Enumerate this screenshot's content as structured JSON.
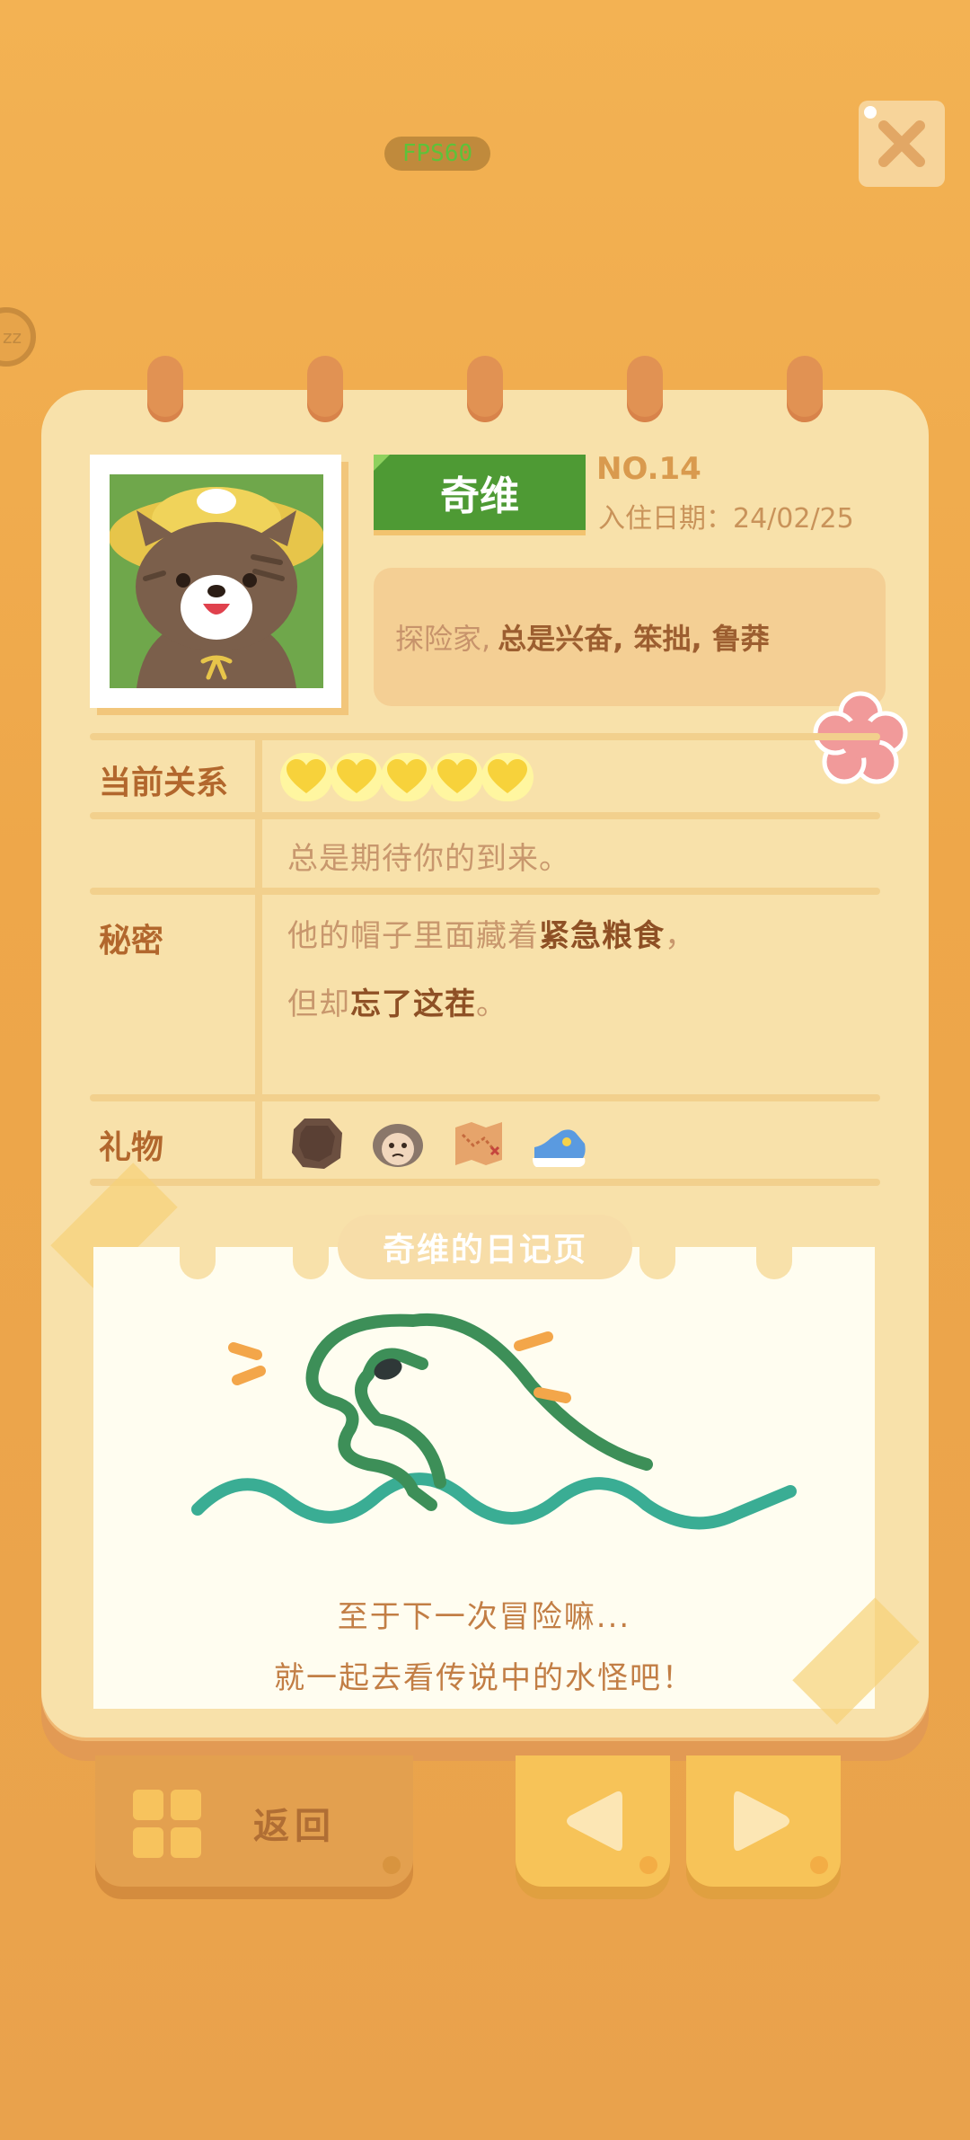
{
  "hud": {
    "fps": "FPS60",
    "sleep_badge": "zz"
  },
  "profile": {
    "name": "奇维",
    "number": "NO.14",
    "move_in_date": "入住日期：24/02/25",
    "traits_lead": "探险家, ",
    "traits_bold": "总是兴奋, 笨拙, 鲁莽"
  },
  "rows": {
    "relation_label": "当前关系",
    "relation_hearts": 5,
    "relation_text": "总是期待你的到来。",
    "secret_label": "秘密",
    "secret_line1_a": "他的帽子里面藏着",
    "secret_line1_b": "紧急粮食",
    "secret_line1_c": "，",
    "secret_line2_a": "但却",
    "secret_line2_b": "忘了这茬",
    "secret_line2_c": "。",
    "gift_label": "礼物",
    "gifts": [
      "rock-icon",
      "mask-icon",
      "map-icon",
      "sneaker-icon"
    ]
  },
  "diary": {
    "title": "奇维的日记页",
    "line1": "至于下一次冒险嘛...",
    "line2": "就一起去看传说中的水怪吧！"
  },
  "nav": {
    "back_label": "返回"
  },
  "colors": {
    "accent_green": "#4e9a34",
    "paper": "#f8e1aa",
    "label_brown": "#b2672d",
    "heart_yellow": "#f7d23b"
  }
}
